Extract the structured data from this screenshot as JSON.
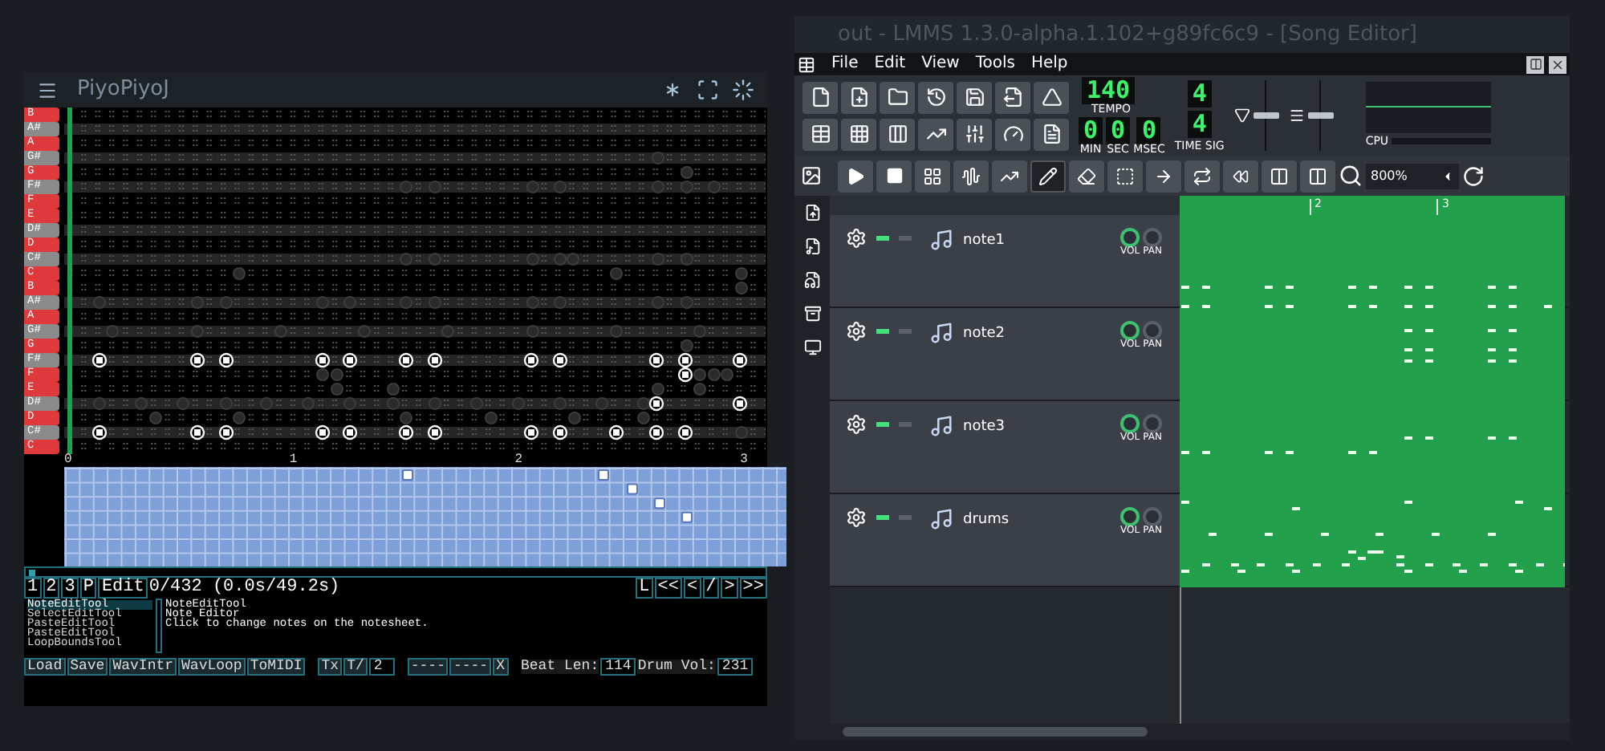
{
  "piyo": {
    "title": "PiyoPiyoJ",
    "keys": [
      {
        "label": "B",
        "kind": "natural"
      },
      {
        "label": "A#",
        "kind": "sharp"
      },
      {
        "label": "A",
        "kind": "natural"
      },
      {
        "label": "G#",
        "kind": "sharp"
      },
      {
        "label": "G",
        "kind": "natural"
      },
      {
        "label": "F#",
        "kind": "sharp"
      },
      {
        "label": "F",
        "kind": "natural"
      },
      {
        "label": "E",
        "kind": "natural"
      },
      {
        "label": "D#",
        "kind": "sharp"
      },
      {
        "label": "D",
        "kind": "natural"
      },
      {
        "label": "C#",
        "kind": "sharp"
      },
      {
        "label": "C",
        "kind": "natural"
      },
      {
        "label": "B",
        "kind": "natural"
      },
      {
        "label": "A#",
        "kind": "sharp"
      },
      {
        "label": "A",
        "kind": "natural"
      },
      {
        "label": "G#",
        "kind": "sharp"
      },
      {
        "label": "G",
        "kind": "natural"
      },
      {
        "label": "F#",
        "kind": "sharp"
      },
      {
        "label": "F",
        "kind": "natural"
      },
      {
        "label": "E",
        "kind": "natural"
      },
      {
        "label": "D#",
        "kind": "sharp"
      },
      {
        "label": "D",
        "kind": "natural"
      },
      {
        "label": "C#",
        "kind": "sharp"
      },
      {
        "label": "C",
        "kind": "natural"
      }
    ],
    "beat_labels": [
      "0",
      "1",
      "2",
      "3"
    ],
    "track_buttons": [
      "1",
      "2",
      "3",
      "P"
    ],
    "mode": "Edit",
    "position": "0/432 (0.0s/49.2s)",
    "nav_buttons": [
      "L",
      "<<",
      "<",
      "/",
      ">",
      ">>"
    ],
    "tools": [
      {
        "label": "NoteEditTool",
        "selected": true
      },
      {
        "label": "SelectEditTool",
        "selected": false
      },
      {
        "label": "PasteEditTool",
        "selected": false
      },
      {
        "label": "PasteEditTool",
        "selected": false
      },
      {
        "label": "LoopBoundsTool",
        "selected": false
      }
    ],
    "tool_info": [
      "NoteEditTool",
      "Note Editor",
      "Click to change notes on the notesheet."
    ],
    "bottom_bar": [
      {
        "kind": "button",
        "text": "Load"
      },
      {
        "kind": "button",
        "text": "Save"
      },
      {
        "kind": "button",
        "text": "WavIntr"
      },
      {
        "kind": "button",
        "text": "WavLoop"
      },
      {
        "kind": "button",
        "text": "ToMIDI"
      },
      {
        "kind": "gap"
      },
      {
        "kind": "button",
        "text": "Tx"
      },
      {
        "kind": "button",
        "text": "T/"
      },
      {
        "kind": "field",
        "text": "2"
      },
      {
        "kind": "gap"
      },
      {
        "kind": "button",
        "text": "----"
      },
      {
        "kind": "button",
        "text": "----"
      },
      {
        "kind": "button",
        "text": "X"
      },
      {
        "kind": "gap"
      },
      {
        "kind": "label",
        "text": "Beat Len:"
      },
      {
        "kind": "field",
        "text": "114"
      },
      {
        "kind": "label",
        "text": "Drum Vol:"
      },
      {
        "kind": "field",
        "text": "231"
      }
    ]
  },
  "lmms": {
    "title": "out - LMMS 1.3.0-alpha.1.102+g89fc6c9 - [Song Editor]",
    "menu": [
      "File",
      "Edit",
      "View",
      "Tools",
      "Help"
    ],
    "tempo": {
      "value": "140",
      "label": "TEMPO"
    },
    "time": [
      {
        "value": "0",
        "label": "MIN"
      },
      {
        "value": "0",
        "label": "SEC"
      },
      {
        "value": "0",
        "label": "MSEC"
      }
    ],
    "time_sig": {
      "numerator": "4",
      "denominator": "4",
      "label": "TIME SIG"
    },
    "sliders": [
      {
        "level": 0.5
      },
      {
        "level": 0.5
      }
    ],
    "cpu_label": "CPU",
    "edit_tools": [
      {
        "kind": "draw",
        "selected": true
      },
      {
        "kind": "erase",
        "selected": false
      },
      {
        "kind": "select",
        "selected": false
      }
    ],
    "zoom": "800%",
    "timeline": [
      "2",
      "3"
    ],
    "tracks": [
      {
        "name": "note1",
        "active": true,
        "solo": false,
        "vol": "VOL",
        "pan": "PAN"
      },
      {
        "name": "note2",
        "active": true,
        "solo": false,
        "vol": "VOL",
        "pan": "PAN"
      },
      {
        "name": "note3",
        "active": true,
        "solo": false,
        "vol": "VOL",
        "pan": "PAN"
      },
      {
        "name": "drums",
        "active": true,
        "solo": false,
        "vol": "VOL",
        "pan": "PAN"
      }
    ]
  }
}
